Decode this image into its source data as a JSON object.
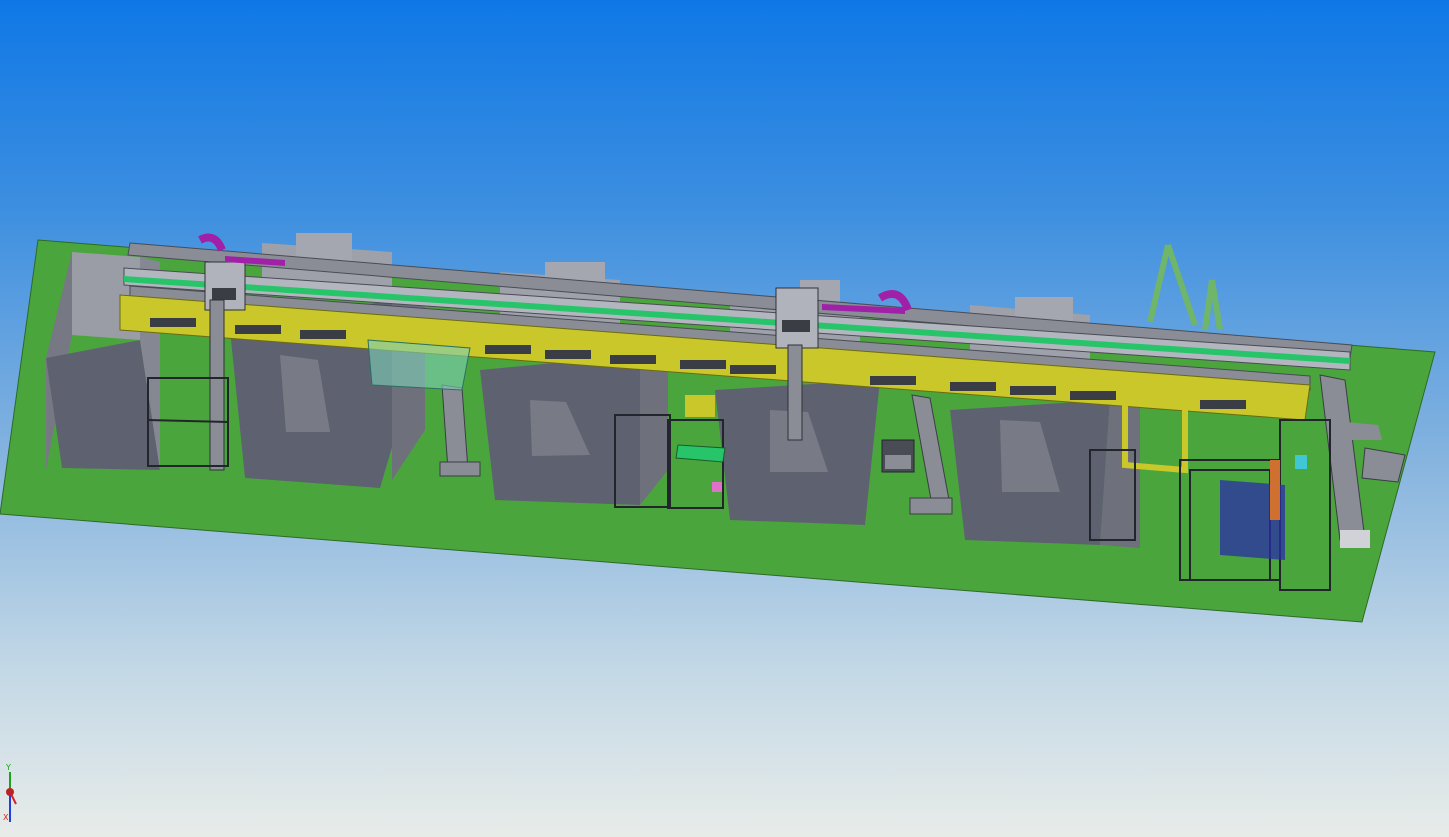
{
  "view": {
    "background_top": "#0f78e6",
    "background_bottom": "#e8ece9"
  },
  "model": {
    "base_plate_color": "#4aa63c",
    "machine_color": "#5e6270",
    "gantry_color": "#c9c72a",
    "rail_color": "#8a8d96",
    "belt_color": "#27c46a",
    "cable_chain_color": "#a020a8",
    "frame_color": "#3a3d44",
    "accent_cyan": "#3fc7d6",
    "accent_blue": "#2a2ca8",
    "support_green": "#6fb56a",
    "machine_count": 4
  },
  "triad": {
    "x_label": "X",
    "y_label": "Y",
    "x_color": "#e02020",
    "y_color": "#20a020",
    "z_color": "#2040e0"
  }
}
